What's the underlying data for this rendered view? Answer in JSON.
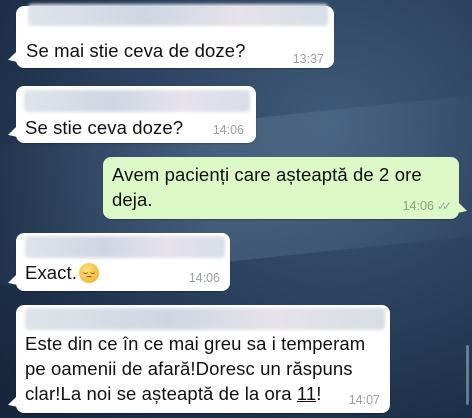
{
  "messages": [
    {
      "direction": "incoming",
      "text": "Se mai stie ceva de doze?",
      "time": "13:37"
    },
    {
      "direction": "incoming",
      "text": "Se stie ceva doze?",
      "time": "14:06"
    },
    {
      "direction": "outgoing",
      "text_line1": "Avem pacienți care așteaptă de 2 ore",
      "text_line2": "deja.",
      "time": "14:06",
      "status": "read"
    },
    {
      "direction": "incoming",
      "text": "Exact.",
      "emoji": "pensive-face",
      "time": "14:06"
    },
    {
      "direction": "incoming",
      "text_line1": "Este din ce în ce mai greu sa i temperam",
      "text_line2": "pe oamenii de afară!Doresc un răspuns",
      "text_line3_pre": "clar!La noi se așteaptă de la ora ",
      "text_line3_ul": "11",
      "text_line3_post": "!",
      "time": "14:07"
    }
  ],
  "colors": {
    "incoming_bubble": "#ffffff",
    "outgoing_bubble": "#dcf8c6",
    "timestamp": "#9aa0a6"
  },
  "icons": {
    "read_receipt": "double-check-icon",
    "emoji": "pensive-face-icon"
  }
}
